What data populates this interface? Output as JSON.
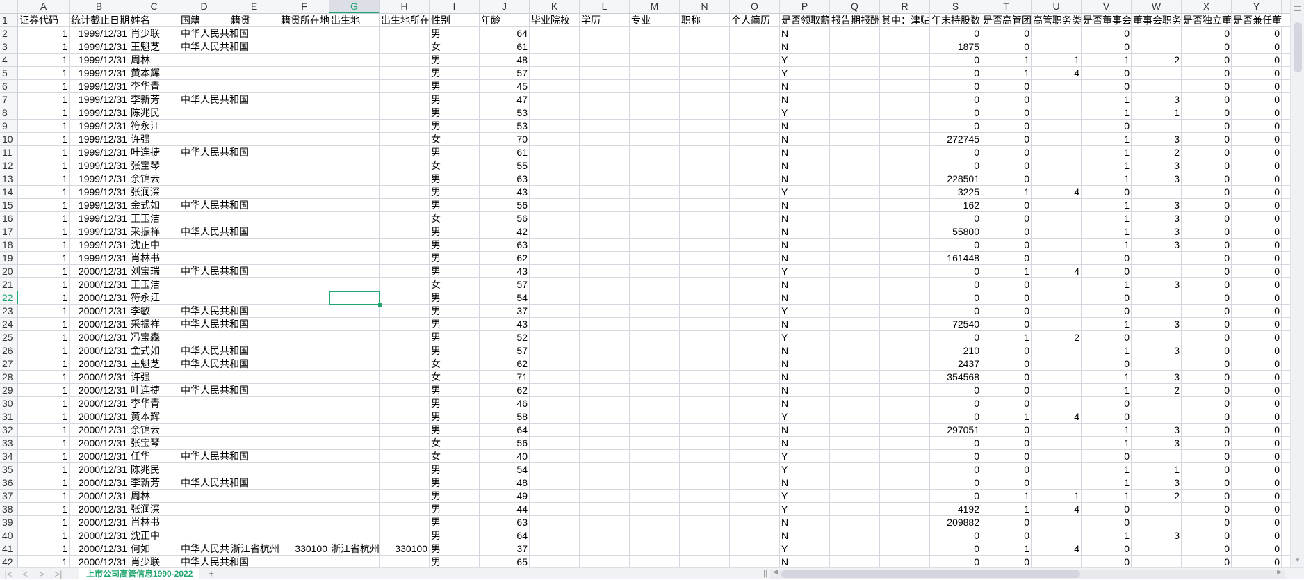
{
  "columns": [
    "A",
    "B",
    "C",
    "D",
    "E",
    "F",
    "G",
    "H",
    "I",
    "J",
    "K",
    "L",
    "M",
    "N",
    "O",
    "P",
    "Q",
    "R",
    "S",
    "T",
    "U",
    "V",
    "W",
    "X",
    "Y"
  ],
  "selected_cell": {
    "column": "G",
    "row": "22"
  },
  "header_row": [
    "证券代码",
    "统计截止日期",
    "姓名",
    "国籍",
    "籍贯",
    "籍贯所在地",
    "出生地",
    "出生地所在",
    "性别",
    "年龄",
    "毕业院校",
    "学历",
    "专业",
    "职称",
    "个人简历",
    "是否领取薪",
    "报告期报酬",
    "其中：津贴",
    "年末持股数",
    "是否高管团",
    "高管职务类",
    "是否董事会",
    "董事会职务",
    "是否独立董",
    "是否兼任董"
  ],
  "rows": [
    [
      "1",
      "1999/12/31",
      "肖少联",
      "中华人民共和国",
      "",
      "",
      "",
      "",
      "男",
      "64",
      "",
      "",
      "",
      "",
      "",
      "N",
      "",
      "",
      "0",
      "0",
      "",
      "0",
      "",
      "0",
      "0"
    ],
    [
      "1",
      "1999/12/31",
      "王魁芝",
      "中华人民共和国",
      "",
      "",
      "",
      "",
      "女",
      "61",
      "",
      "",
      "",
      "",
      "",
      "N",
      "",
      "",
      "1875",
      "0",
      "",
      "0",
      "",
      "0",
      "0"
    ],
    [
      "1",
      "1999/12/31",
      "周林",
      "",
      "",
      "",
      "",
      "",
      "男",
      "48",
      "",
      "",
      "",
      "",
      "",
      "Y",
      "",
      "",
      "0",
      "1",
      "1",
      "1",
      "2",
      "0",
      "0"
    ],
    [
      "1",
      "1999/12/31",
      "黄本辉",
      "",
      "",
      "",
      "",
      "",
      "男",
      "57",
      "",
      "",
      "",
      "",
      "",
      "Y",
      "",
      "",
      "0",
      "1",
      "4",
      "0",
      "",
      "0",
      "0"
    ],
    [
      "1",
      "1999/12/31",
      "李华青",
      "",
      "",
      "",
      "",
      "",
      "男",
      "45",
      "",
      "",
      "",
      "",
      "",
      "N",
      "",
      "",
      "0",
      "0",
      "",
      "0",
      "",
      "0",
      "0"
    ],
    [
      "1",
      "1999/12/31",
      "李新芳",
      "中华人民共和国",
      "",
      "",
      "",
      "",
      "男",
      "47",
      "",
      "",
      "",
      "",
      "",
      "N",
      "",
      "",
      "0",
      "0",
      "",
      "1",
      "3",
      "0",
      "0"
    ],
    [
      "1",
      "1999/12/31",
      "陈兆民",
      "",
      "",
      "",
      "",
      "",
      "男",
      "53",
      "",
      "",
      "",
      "",
      "",
      "Y",
      "",
      "",
      "0",
      "0",
      "",
      "1",
      "1",
      "0",
      "0"
    ],
    [
      "1",
      "1999/12/31",
      "符永江",
      "",
      "",
      "",
      "",
      "",
      "男",
      "53",
      "",
      "",
      "",
      "",
      "",
      "N",
      "",
      "",
      "0",
      "0",
      "",
      "0",
      "",
      "0",
      "0"
    ],
    [
      "1",
      "1999/12/31",
      "许强",
      "",
      "",
      "",
      "",
      "",
      "女",
      "70",
      "",
      "",
      "",
      "",
      "",
      "N",
      "",
      "",
      "272745",
      "0",
      "",
      "1",
      "3",
      "0",
      "0"
    ],
    [
      "1",
      "1999/12/31",
      "叶连捷",
      "中华人民共和国",
      "",
      "",
      "",
      "",
      "男",
      "61",
      "",
      "",
      "",
      "",
      "",
      "N",
      "",
      "",
      "0",
      "0",
      "",
      "1",
      "2",
      "0",
      "0"
    ],
    [
      "1",
      "1999/12/31",
      "张宝琴",
      "",
      "",
      "",
      "",
      "",
      "女",
      "55",
      "",
      "",
      "",
      "",
      "",
      "N",
      "",
      "",
      "0",
      "0",
      "",
      "1",
      "3",
      "0",
      "0"
    ],
    [
      "1",
      "1999/12/31",
      "余锦云",
      "",
      "",
      "",
      "",
      "",
      "男",
      "63",
      "",
      "",
      "",
      "",
      "",
      "N",
      "",
      "",
      "228501",
      "0",
      "",
      "1",
      "3",
      "0",
      "0"
    ],
    [
      "1",
      "1999/12/31",
      "张润深",
      "",
      "",
      "",
      "",
      "",
      "男",
      "43",
      "",
      "",
      "",
      "",
      "",
      "Y",
      "",
      "",
      "3225",
      "1",
      "4",
      "0",
      "",
      "0",
      "0"
    ],
    [
      "1",
      "1999/12/31",
      "金式如",
      "中华人民共和国",
      "",
      "",
      "",
      "",
      "男",
      "56",
      "",
      "",
      "",
      "",
      "",
      "N",
      "",
      "",
      "162",
      "0",
      "",
      "1",
      "3",
      "0",
      "0"
    ],
    [
      "1",
      "1999/12/31",
      "王玉洁",
      "",
      "",
      "",
      "",
      "",
      "女",
      "56",
      "",
      "",
      "",
      "",
      "",
      "N",
      "",
      "",
      "0",
      "0",
      "",
      "1",
      "3",
      "0",
      "0"
    ],
    [
      "1",
      "1999/12/31",
      "采振祥",
      "中华人民共和国",
      "",
      "",
      "",
      "",
      "男",
      "42",
      "",
      "",
      "",
      "",
      "",
      "N",
      "",
      "",
      "55800",
      "0",
      "",
      "1",
      "3",
      "0",
      "0"
    ],
    [
      "1",
      "1999/12/31",
      "沈正中",
      "",
      "",
      "",
      "",
      "",
      "男",
      "63",
      "",
      "",
      "",
      "",
      "",
      "N",
      "",
      "",
      "0",
      "0",
      "",
      "1",
      "3",
      "0",
      "0"
    ],
    [
      "1",
      "1999/12/31",
      "肖林书",
      "",
      "",
      "",
      "",
      "",
      "男",
      "62",
      "",
      "",
      "",
      "",
      "",
      "N",
      "",
      "",
      "161448",
      "0",
      "",
      "0",
      "",
      "0",
      "0"
    ],
    [
      "1",
      "2000/12/31",
      "刘宝瑞",
      "中华人民共和国",
      "",
      "",
      "",
      "",
      "男",
      "43",
      "",
      "",
      "",
      "",
      "",
      "Y",
      "",
      "",
      "0",
      "1",
      "4",
      "0",
      "",
      "0",
      "0"
    ],
    [
      "1",
      "2000/12/31",
      "王玉洁",
      "",
      "",
      "",
      "",
      "",
      "女",
      "57",
      "",
      "",
      "",
      "",
      "",
      "N",
      "",
      "",
      "0",
      "0",
      "",
      "1",
      "3",
      "0",
      "0"
    ],
    [
      "1",
      "2000/12/31",
      "符永江",
      "",
      "",
      "",
      "",
      "",
      "男",
      "54",
      "",
      "",
      "",
      "",
      "",
      "N",
      "",
      "",
      "0",
      "0",
      "",
      "0",
      "",
      "0",
      "0"
    ],
    [
      "1",
      "2000/12/31",
      "李敏",
      "中华人民共和国",
      "",
      "",
      "",
      "",
      "男",
      "37",
      "",
      "",
      "",
      "",
      "",
      "Y",
      "",
      "",
      "0",
      "0",
      "",
      "0",
      "",
      "0",
      "0"
    ],
    [
      "1",
      "2000/12/31",
      "采振祥",
      "中华人民共和国",
      "",
      "",
      "",
      "",
      "男",
      "43",
      "",
      "",
      "",
      "",
      "",
      "N",
      "",
      "",
      "72540",
      "0",
      "",
      "1",
      "3",
      "0",
      "0"
    ],
    [
      "1",
      "2000/12/31",
      "冯宝森",
      "",
      "",
      "",
      "",
      "",
      "男",
      "52",
      "",
      "",
      "",
      "",
      "",
      "Y",
      "",
      "",
      "0",
      "1",
      "2",
      "0",
      "",
      "0",
      "0"
    ],
    [
      "1",
      "2000/12/31",
      "金式如",
      "中华人民共和国",
      "",
      "",
      "",
      "",
      "男",
      "57",
      "",
      "",
      "",
      "",
      "",
      "N",
      "",
      "",
      "210",
      "0",
      "",
      "1",
      "3",
      "0",
      "0"
    ],
    [
      "1",
      "2000/12/31",
      "王魁芝",
      "中华人民共和国",
      "",
      "",
      "",
      "",
      "女",
      "62",
      "",
      "",
      "",
      "",
      "",
      "N",
      "",
      "",
      "2437",
      "0",
      "",
      "0",
      "",
      "0",
      "0"
    ],
    [
      "1",
      "2000/12/31",
      "许强",
      "",
      "",
      "",
      "",
      "",
      "女",
      "71",
      "",
      "",
      "",
      "",
      "",
      "N",
      "",
      "",
      "354568",
      "0",
      "",
      "1",
      "3",
      "0",
      "0"
    ],
    [
      "1",
      "2000/12/31",
      "叶连捷",
      "中华人民共和国",
      "",
      "",
      "",
      "",
      "男",
      "62",
      "",
      "",
      "",
      "",
      "",
      "N",
      "",
      "",
      "0",
      "0",
      "",
      "1",
      "2",
      "0",
      "0"
    ],
    [
      "1",
      "2000/12/31",
      "李华青",
      "",
      "",
      "",
      "",
      "",
      "男",
      "46",
      "",
      "",
      "",
      "",
      "",
      "N",
      "",
      "",
      "0",
      "0",
      "",
      "0",
      "",
      "0",
      "0"
    ],
    [
      "1",
      "2000/12/31",
      "黄本辉",
      "",
      "",
      "",
      "",
      "",
      "男",
      "58",
      "",
      "",
      "",
      "",
      "",
      "Y",
      "",
      "",
      "0",
      "1",
      "4",
      "0",
      "",
      "0",
      "0"
    ],
    [
      "1",
      "2000/12/31",
      "余锦云",
      "",
      "",
      "",
      "",
      "",
      "男",
      "64",
      "",
      "",
      "",
      "",
      "",
      "N",
      "",
      "",
      "297051",
      "0",
      "",
      "1",
      "3",
      "0",
      "0"
    ],
    [
      "1",
      "2000/12/31",
      "张宝琴",
      "",
      "",
      "",
      "",
      "",
      "女",
      "56",
      "",
      "",
      "",
      "",
      "",
      "N",
      "",
      "",
      "0",
      "0",
      "",
      "1",
      "3",
      "0",
      "0"
    ],
    [
      "1",
      "2000/12/31",
      "任华",
      "中华人民共和国",
      "",
      "",
      "",
      "",
      "女",
      "40",
      "",
      "",
      "",
      "",
      "",
      "Y",
      "",
      "",
      "0",
      "0",
      "",
      "0",
      "",
      "0",
      "0"
    ],
    [
      "1",
      "2000/12/31",
      "陈兆民",
      "",
      "",
      "",
      "",
      "",
      "男",
      "54",
      "",
      "",
      "",
      "",
      "",
      "Y",
      "",
      "",
      "0",
      "0",
      "",
      "1",
      "1",
      "0",
      "0"
    ],
    [
      "1",
      "2000/12/31",
      "李新芳",
      "中华人民共和国",
      "",
      "",
      "",
      "",
      "男",
      "48",
      "",
      "",
      "",
      "",
      "",
      "N",
      "",
      "",
      "0",
      "0",
      "",
      "1",
      "3",
      "0",
      "0"
    ],
    [
      "1",
      "2000/12/31",
      "周林",
      "",
      "",
      "",
      "",
      "",
      "男",
      "49",
      "",
      "",
      "",
      "",
      "",
      "Y",
      "",
      "",
      "0",
      "1",
      "1",
      "1",
      "2",
      "0",
      "0"
    ],
    [
      "1",
      "2000/12/31",
      "张润深",
      "",
      "",
      "",
      "",
      "",
      "男",
      "44",
      "",
      "",
      "",
      "",
      "",
      "Y",
      "",
      "",
      "4192",
      "1",
      "4",
      "0",
      "",
      "0",
      "0"
    ],
    [
      "1",
      "2000/12/31",
      "肖林书",
      "",
      "",
      "",
      "",
      "",
      "男",
      "63",
      "",
      "",
      "",
      "",
      "",
      "N",
      "",
      "",
      "209882",
      "0",
      "",
      "0",
      "",
      "0",
      "0"
    ],
    [
      "1",
      "2000/12/31",
      "沈正中",
      "",
      "",
      "",
      "",
      "",
      "男",
      "64",
      "",
      "",
      "",
      "",
      "",
      "N",
      "",
      "",
      "0",
      "0",
      "",
      "1",
      "3",
      "0",
      "0"
    ],
    [
      "1",
      "2000/12/31",
      "何如",
      "中华人民共和国",
      "浙江省杭州",
      "330100",
      "浙江省杭州",
      "330100",
      "男",
      "37",
      "",
      "",
      "",
      "",
      "",
      "Y",
      "",
      "",
      "0",
      "1",
      "4",
      "0",
      "",
      "0",
      "0"
    ],
    [
      "1",
      "2000/12/31",
      "肖少联",
      "中华人民共和国",
      "",
      "",
      "",
      "",
      "男",
      "65",
      "",
      "",
      "",
      "",
      "",
      "N",
      "",
      "",
      "0",
      "0",
      "",
      "0",
      "",
      "0",
      "0"
    ]
  ],
  "sheet_tabs": [
    {
      "label": "上市公司高管信息1990-2022",
      "active": true
    }
  ],
  "add_sheet_label": "+",
  "nav": {
    "first": "|<",
    "prev": "<",
    "next": ">",
    "last": ">|"
  },
  "colors": {
    "accent": "#1fa56d",
    "grid": "#d4d7e0",
    "header_bg": "#f5f6f8"
  }
}
